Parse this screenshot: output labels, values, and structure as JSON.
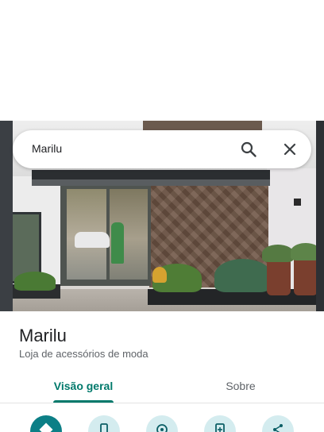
{
  "search": {
    "query": "Marilu"
  },
  "place": {
    "name": "Marilu",
    "category": "Loja de acessórios de moda"
  },
  "tabs": [
    {
      "label": "Visão geral",
      "active": true
    },
    {
      "label": "Sobre",
      "active": false
    }
  ],
  "actions": [
    {
      "icon": "directions-icon",
      "primary": true
    },
    {
      "icon": "phone-icon",
      "primary": false
    },
    {
      "icon": "location-icon",
      "primary": false
    },
    {
      "icon": "save-icon",
      "primary": false
    },
    {
      "icon": "share-icon",
      "primary": false
    }
  ],
  "colors": {
    "accent": "#00796b",
    "action_primary": "#0c7f86",
    "action_secondary_bg": "#d4ecef"
  }
}
